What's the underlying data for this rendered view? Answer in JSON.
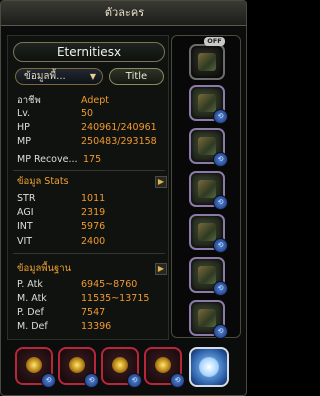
{
  "window": {
    "title": "ตัวละคร"
  },
  "character": {
    "name": "Eternitiesx"
  },
  "controls": {
    "info_dropdown": "ข้อมูลพื้...",
    "title_button": "Title"
  },
  "basic": [
    {
      "label": "อาชีพ",
      "value": "Adept"
    },
    {
      "label": "Lv.",
      "value": "50"
    },
    {
      "label": "HP",
      "value": "240961/240961"
    },
    {
      "label": "MP",
      "value": "250483/293158"
    },
    {
      "label": "MP Recove...",
      "value": "175"
    }
  ],
  "stats_section": {
    "title": "ข้อมูล Stats"
  },
  "stats": [
    {
      "label": "STR",
      "value": "1011"
    },
    {
      "label": "AGI",
      "value": "2319"
    },
    {
      "label": "INT",
      "value": "5976"
    },
    {
      "label": "VIT",
      "value": "2400"
    }
  ],
  "base_section": {
    "title": "ข้อมูลพื้นฐาน"
  },
  "base": [
    {
      "label": "P. Atk",
      "value": "6945~8760"
    },
    {
      "label": "M. Atk",
      "value": "11535~13715"
    },
    {
      "label": "P. Def",
      "value": "7547"
    },
    {
      "label": "M. Def",
      "value": "13396"
    }
  ],
  "equipment": {
    "off_label": "OFF",
    "slot_badge": "⟲"
  }
}
